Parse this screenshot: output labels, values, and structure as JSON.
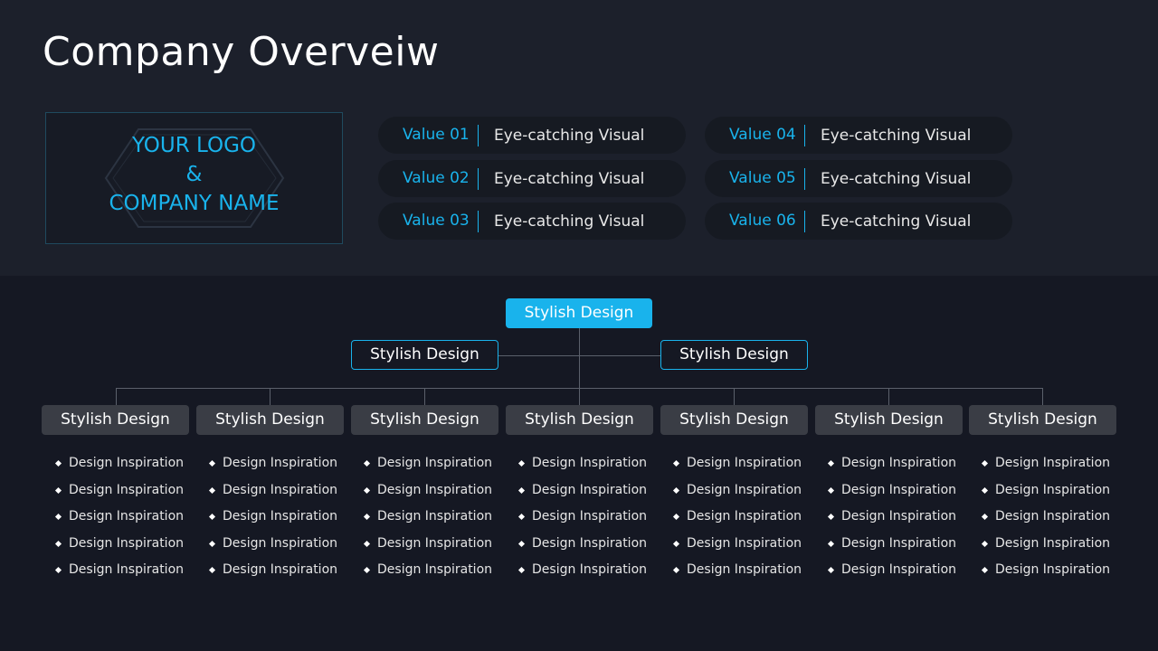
{
  "title": "Company Overveiw",
  "logo": {
    "line1": "YOUR LOGO",
    "line2": "&",
    "line3": "COMPANY NAME"
  },
  "values": [
    {
      "label": "Value 01",
      "text": "Eye-catching Visual"
    },
    {
      "label": "Value 02",
      "text": "Eye-catching Visual"
    },
    {
      "label": "Value 03",
      "text": "Eye-catching Visual"
    },
    {
      "label": "Value 04",
      "text": "Eye-catching Visual"
    },
    {
      "label": "Value 05",
      "text": "Eye-catching Visual"
    },
    {
      "label": "Value 06",
      "text": "Eye-catching Visual"
    }
  ],
  "org": {
    "root": "Stylish Design",
    "mid": [
      "Stylish Design",
      "Stylish Design"
    ],
    "leaves": [
      {
        "label": "Stylish Design",
        "items": [
          "Design Inspiration",
          "Design Inspiration",
          "Design Inspiration",
          "Design Inspiration",
          "Design Inspiration"
        ]
      },
      {
        "label": "Stylish Design",
        "items": [
          "Design Inspiration",
          "Design Inspiration",
          "Design Inspiration",
          "Design Inspiration",
          "Design Inspiration"
        ]
      },
      {
        "label": "Stylish Design",
        "items": [
          "Design Inspiration",
          "Design Inspiration",
          "Design Inspiration",
          "Design Inspiration",
          "Design Inspiration"
        ]
      },
      {
        "label": "Stylish Design",
        "items": [
          "Design Inspiration",
          "Design Inspiration",
          "Design Inspiration",
          "Design Inspiration",
          "Design Inspiration"
        ]
      },
      {
        "label": "Stylish Design",
        "items": [
          "Design Inspiration",
          "Design Inspiration",
          "Design Inspiration",
          "Design Inspiration",
          "Design Inspiration"
        ]
      },
      {
        "label": "Stylish Design",
        "items": [
          "Design Inspiration",
          "Design Inspiration",
          "Design Inspiration",
          "Design Inspiration",
          "Design Inspiration"
        ]
      },
      {
        "label": "Stylish Design",
        "items": [
          "Design Inspiration",
          "Design Inspiration",
          "Design Inspiration",
          "Design Inspiration",
          "Design Inspiration"
        ]
      }
    ]
  },
  "colors": {
    "accent": "#19b3ec",
    "background": "#151823",
    "band": "#1c202b",
    "leaf": "#3a3d45"
  }
}
